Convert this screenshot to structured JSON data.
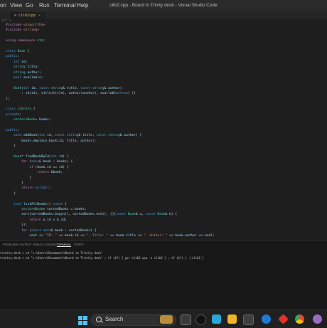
{
  "titlebar": {
    "menu": [
      "on",
      "View",
      "Go",
      "Run",
      "Terminal",
      "Help"
    ],
    "title": "clib2.cpp - Board in Trinity desk - Visual Studio Code"
  },
  "tab": {
    "label": "≡ clib2cpp",
    "close": "×"
  },
  "breadcrumb": "src >",
  "code": [
    "#include <algorithm>",
    "#include <string>",
    "",
    "using namespace std;",
    "",
    "class Book {",
    "public:",
    "    int id;",
    "    string title;",
    "    string author;",
    "    bool available;",
    "",
    "    Book(int id, const string& title, const string& author)",
    "        : id(id), title(title), author(author), available(true) {}",
    "};",
    "",
    "class Library {",
    "private:",
    "    vector<Book> books;",
    "",
    "public:",
    "    void addBook(int id, const string& title, const string& author) {",
    "        books.emplace_back(id, title, author);",
    "    }",
    "",
    "    Book* findBookById(int id) {",
    "        for (auto& book : books) {",
    "            if (book.id == id) {",
    "                return &book;",
    "            }",
    "        }",
    "        return nullptr;",
    "    }",
    "",
    "    void listAllBooks() const {",
    "        vector<Book> sortedBooks = books;",
    "        sort(sortedBooks.begin(), sortedBooks.end(), [](const Book& a, const Book& b) {",
    "            return a.id < b.id;",
    "        });",
    "        for (const auto& book : sortedBooks) {",
    "            cout << \"ID: \" << book.id << \", Title: \" << book.title << \", Author: \" << book.author << endl;"
  ],
  "panel": {
    "tabs": [
      "PROBLEMS",
      "OUTPUT",
      "DEBUG CONSOLE",
      "TERMINAL",
      "PORTS"
    ],
    "terminal_lines": [
      "trinity.desk > cd \"c:\\Users\\Documents\\Board in Trinity desk\"",
      "trinity.desk > cd \"c:\\Users\\Documents\\Board in Trinity desk\" ; if ($?) { g++ clib2.cpp -o clib2 } ; if ($?) { .\\clib2 }"
    ]
  },
  "taskbar": {
    "search_label": "Search",
    "icons": [
      "windows-icon",
      "search-icon",
      "task-view-icon",
      "chat-icon",
      "file-explorer-icon",
      "mail-icon",
      "edge-icon",
      "store-icon",
      "chrome-icon",
      "settings-icon"
    ]
  }
}
